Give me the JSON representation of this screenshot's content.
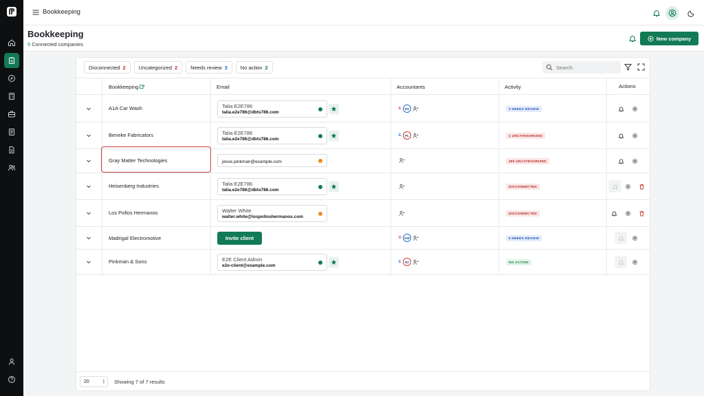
{
  "topbar": {
    "title": "Bookkeeping"
  },
  "header": {
    "title": "Bookkeeping",
    "connected_count": "5",
    "connected_label": "Connected companies",
    "new_company_label": "New company"
  },
  "filters": [
    {
      "label": "Disconnected",
      "count": "2",
      "color": "#c53030"
    },
    {
      "label": "Uncategorized",
      "count": "2",
      "color": "#c53030"
    },
    {
      "label": "Needs review",
      "count": "3",
      "color": "#1e6fd9"
    },
    {
      "label": "No action",
      "count": "2",
      "color": "#177a3f"
    }
  ],
  "search": {
    "placeholder": "Search"
  },
  "columns": {
    "bookkeeping": "Bookkeeping",
    "email": "Email",
    "accountants": "Accountants",
    "activity": "Activity",
    "actions": "Actions"
  },
  "rows": [
    {
      "company": "A1A Car Wash",
      "contact_name": "Talia E2E786",
      "contact_email": "talia.e2e786@dbts786.com",
      "status_color": "#127a55",
      "starred": true,
      "accountants": [
        {
          "initials": "E",
          "ring": "red"
        },
        {
          "initials": "ES",
          "ring": "blue"
        }
      ],
      "activity": "3 NEEDS REVIEW",
      "activity_tone": "blue",
      "actions": [
        "bell",
        "gear"
      ]
    },
    {
      "company": "Beneke Fabricators",
      "contact_name": "Talia E2E786",
      "contact_email": "talia.e2e786@dbts786.com",
      "status_color": "#127a55",
      "starred": true,
      "accountants": [
        {
          "initials": "E",
          "ring": "blue"
        },
        {
          "initials": "PL",
          "ring": "red"
        }
      ],
      "activity": "1 UNCATEGORIZED",
      "activity_tone": "red",
      "actions": [
        "bell",
        "gear"
      ]
    },
    {
      "company": "Gray Matter Technologies",
      "contact_name": "",
      "contact_email": "jesse.pinkman@example.com",
      "status_color": "#f08a24",
      "starred": false,
      "accountants": [],
      "activity": "350 UNCATEGORIZED",
      "activity_tone": "red",
      "actions": [
        "bell",
        "gear"
      ]
    },
    {
      "company": "Heisenberg Industries",
      "contact_name": "Talia E2E786",
      "contact_email": "talia.e2e786@dbts786.com",
      "status_color": "#127a55",
      "starred": true,
      "accountants": [],
      "activity": "DISCONNECTED",
      "activity_tone": "red",
      "actions": [
        "bell-disabled",
        "gear",
        "trash"
      ]
    },
    {
      "company": "Los Pollos Hermanos",
      "contact_name": "Walter White",
      "contact_email": "walter.white@lospolloshermanos.com",
      "status_color": "#f08a24",
      "starred": false,
      "accountants": [],
      "activity": "DISCONNECTED",
      "activity_tone": "red",
      "actions": [
        "bell",
        "gear",
        "trash"
      ]
    },
    {
      "company": "Madrigal Electromotive",
      "invite_label": "Invite client",
      "accountants": [
        {
          "initials": "D",
          "ring": "red"
        },
        {
          "initials": "KW",
          "ring": "blue"
        }
      ],
      "activity": "5 NEEDS REVIEW",
      "activity_tone": "blue",
      "actions": [
        "bell-disabled",
        "gear"
      ]
    },
    {
      "company": "Pinkman & Sons",
      "contact_name": "E2E Client Admin",
      "contact_email": "e2e-client@example.com",
      "status_color": "#127a55",
      "starred": true,
      "accountants": [
        {
          "initials": "E",
          "ring": "blue"
        },
        {
          "initials": "E2",
          "ring": "red"
        }
      ],
      "activity": "NO ACTION",
      "activity_tone": "green",
      "actions": [
        "bell-disabled",
        "gear"
      ]
    }
  ],
  "footer": {
    "page_size": "20",
    "showing": "Showing 7 of 7 results"
  },
  "colors": {
    "accent": "#127a55",
    "highlight": "#c9423f"
  }
}
